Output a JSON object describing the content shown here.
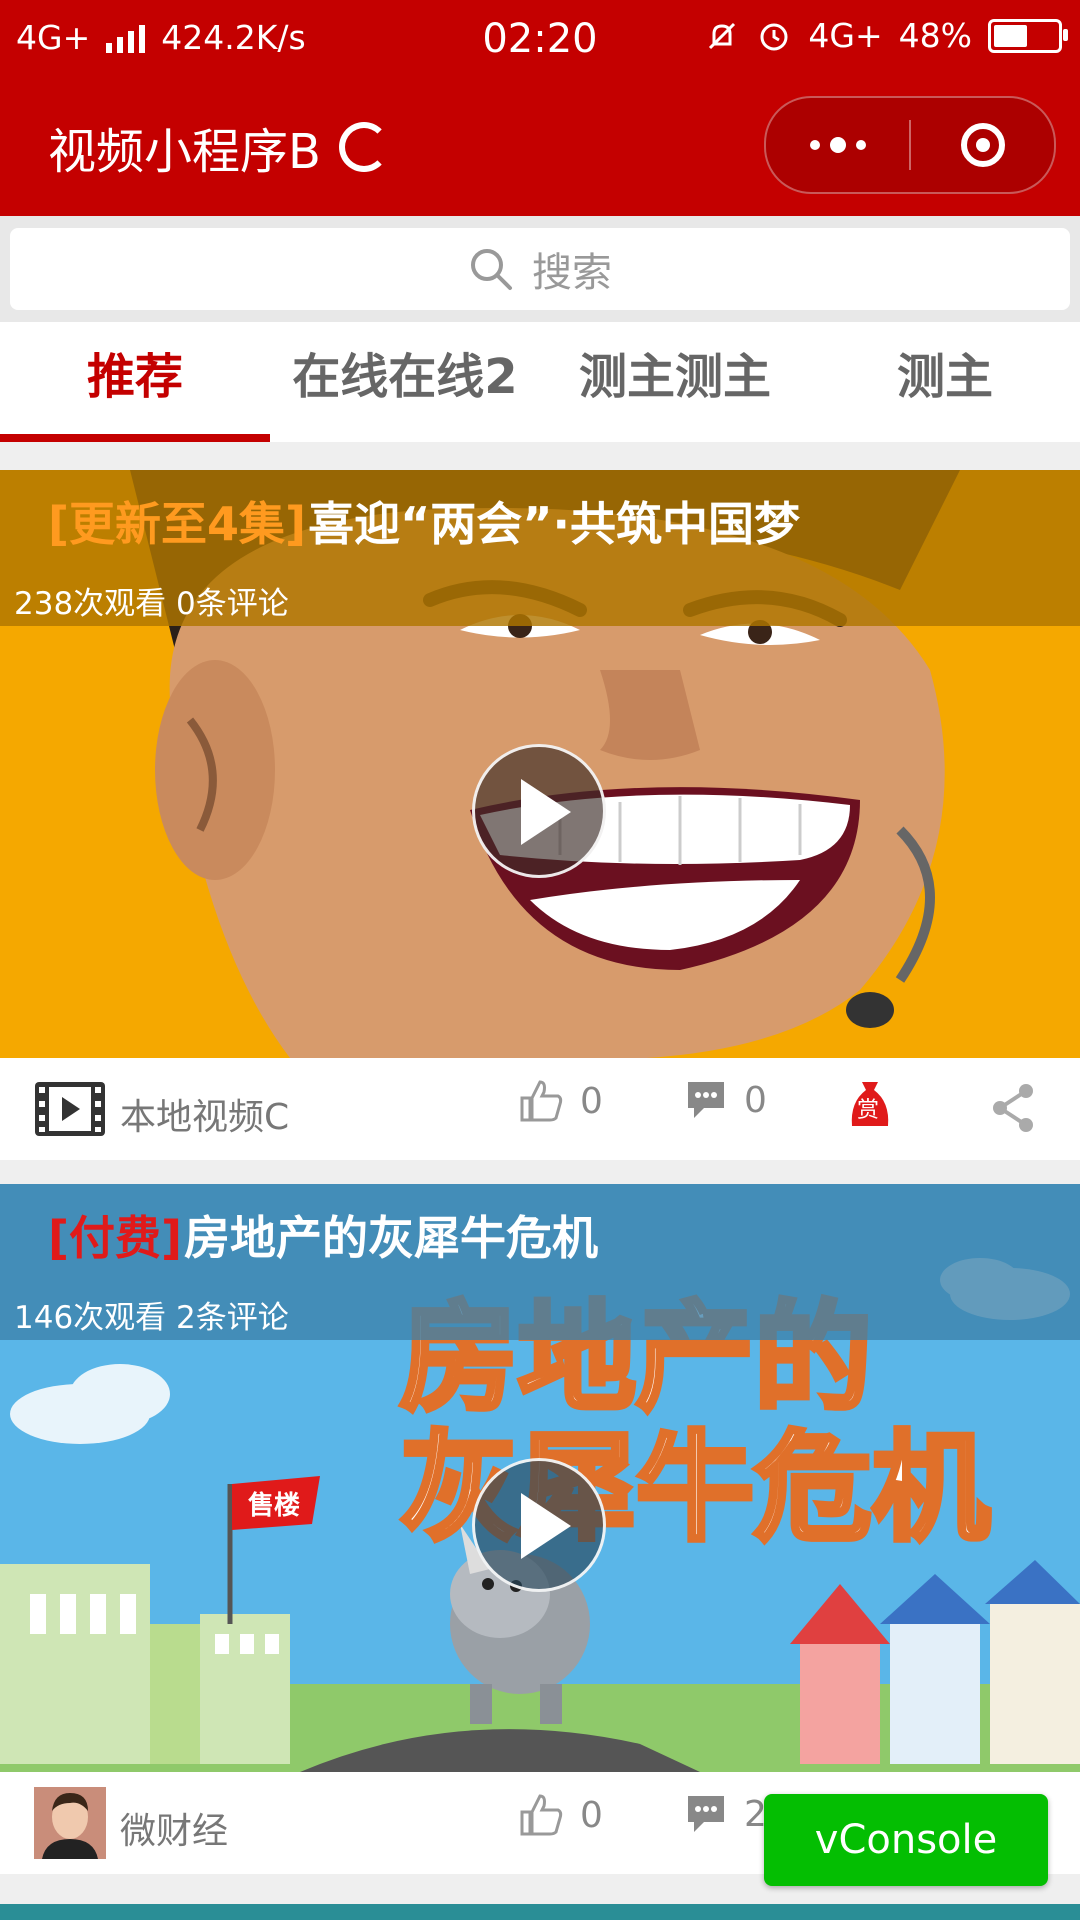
{
  "status_bar": {
    "network": "4G+",
    "speed": "424.2K/s",
    "time": "02:20",
    "network2": "4G+",
    "battery": "48%",
    "battery_level": 0.48
  },
  "header": {
    "title": "视频小程序B"
  },
  "search": {
    "placeholder": "搜索"
  },
  "tabs": [
    {
      "label": "推荐",
      "active": true
    },
    {
      "label": "在线在线2",
      "active": false
    },
    {
      "label": "测主测主",
      "active": false
    },
    {
      "label": "测主",
      "active": false
    }
  ],
  "videos": [
    {
      "tag": "[更新至4集]",
      "title": "喜迎“两会”·共筑中国梦",
      "meta": "238次观看 0条评论",
      "author": "本地视频C",
      "likes": "0",
      "comments": "0",
      "reward": "赏"
    },
    {
      "tag": "[付费]",
      "title": "房地产的灰犀牛危机",
      "meta": "146次观看 2条评论",
      "author": "微财经",
      "likes": "0",
      "comments": "2",
      "poster_text_1": "房地产的",
      "poster_text_2": "灰犀牛危机",
      "poster_flag": "售楼"
    }
  ],
  "vconsole": {
    "label": "vConsole"
  },
  "colors": {
    "brand_red": "#c40000",
    "tag_orange": "#ff9a1f",
    "tag_red": "#e01a1a",
    "vconsole_green": "#04be02"
  }
}
